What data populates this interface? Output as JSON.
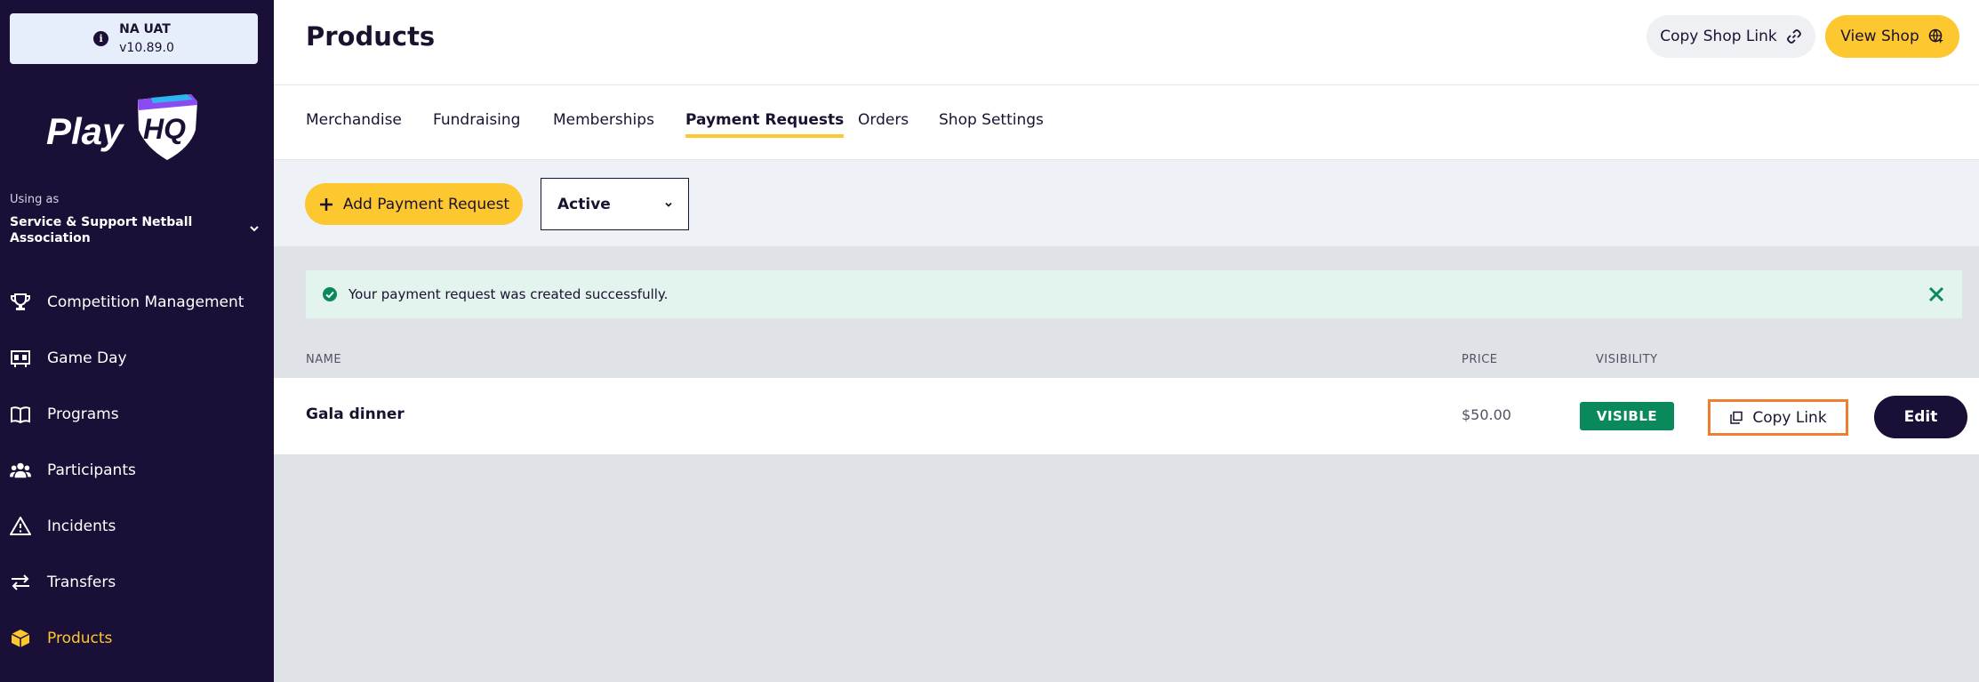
{
  "environment": {
    "name": "NA UAT",
    "version": "v10.89.0",
    "info_icon": "info-icon"
  },
  "logo": {
    "text": "Play",
    "badge_text": "HQ"
  },
  "account": {
    "using_as_label": "Using as",
    "org_name": "Service & Support Netball Association"
  },
  "sidebar": {
    "items": [
      {
        "label": "Competition Management",
        "icon": "trophy-icon",
        "active": false
      },
      {
        "label": "Game Day",
        "icon": "scoreboard-icon",
        "active": false
      },
      {
        "label": "Programs",
        "icon": "book-icon",
        "active": false
      },
      {
        "label": "Participants",
        "icon": "people-icon",
        "active": false
      },
      {
        "label": "Incidents",
        "icon": "warning-icon",
        "active": false
      },
      {
        "label": "Transfers",
        "icon": "transfer-arrows-icon",
        "active": false
      },
      {
        "label": "Products",
        "icon": "box-icon",
        "active": true
      }
    ]
  },
  "header": {
    "title": "Products",
    "copy_shop_link_label": "Copy Shop Link",
    "view_shop_label": "View Shop"
  },
  "tabs": [
    {
      "label": "Merchandise",
      "active": false
    },
    {
      "label": "Fundraising",
      "active": false
    },
    {
      "label": "Memberships",
      "active": false
    },
    {
      "label": "Payment Requests",
      "active": true
    },
    {
      "label": "Orders",
      "active": false
    },
    {
      "label": "Shop Settings",
      "active": false
    }
  ],
  "toolbar": {
    "add_label": "Add Payment Request",
    "status_selected": "Active"
  },
  "alert": {
    "message": "Your payment request was created successfully."
  },
  "table": {
    "columns": {
      "name": "NAME",
      "price": "PRICE",
      "visibility": "VISIBILITY"
    },
    "rows": [
      {
        "name": "Gala dinner",
        "price": "$50.00",
        "visibility": "VISIBLE",
        "copy_link_label": "Copy Link",
        "edit_label": "Edit"
      }
    ]
  },
  "colors": {
    "sidebar_bg": "#1a0f36",
    "accent_yellow": "#fdc72f",
    "success_green": "#0a8a5a",
    "highlight_orange": "#ee7f32"
  }
}
